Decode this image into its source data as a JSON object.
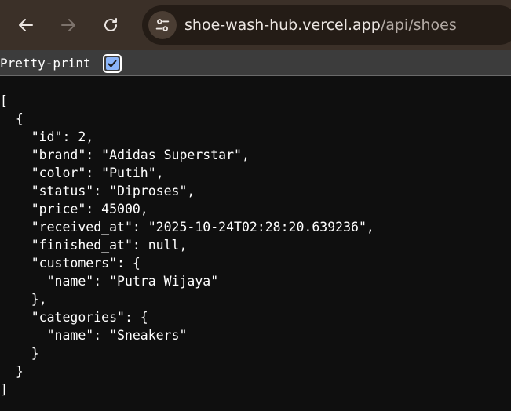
{
  "browser": {
    "url_host": "shoe-wash-hub.vercel.app",
    "url_path": "/api/shoes",
    "icons": {
      "back": "back-arrow-icon",
      "forward": "forward-arrow-icon",
      "reload": "reload-icon",
      "site_info": "tune-icon"
    }
  },
  "pretty_print": {
    "label": "Pretty-print",
    "checked": true,
    "accent_color": "#8ab4f8"
  },
  "json_lines": [
    "[",
    "  {",
    "    \"id\": 2,",
    "    \"brand\": \"Adidas Superstar\",",
    "    \"color\": \"Putih\",",
    "    \"status\": \"Diproses\",",
    "    \"price\": 45000,",
    "    \"received_at\": \"2025-10-24T02:28:20.639236\",",
    "    \"finished_at\": null,",
    "    \"customers\": {",
    "      \"name\": \"Putra Wijaya\"",
    "    },",
    "    \"categories\": {",
    "      \"name\": \"Sneakers\"",
    "    }",
    "  }",
    "]"
  ]
}
